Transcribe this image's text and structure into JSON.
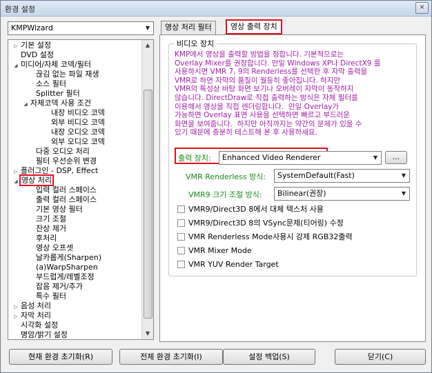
{
  "window": {
    "title": "환경 설정",
    "close_icon": "×"
  },
  "left": {
    "profile_combo": "KMPWizard",
    "tree": [
      {
        "label": "기본 설정",
        "exp": "▷",
        "indent": 0
      },
      {
        "label": "DVD 설정",
        "exp": "",
        "indent": 0
      },
      {
        "label": "미디어/자체 코덱/필터",
        "exp": "◢",
        "indent": 0
      },
      {
        "label": "끊김 없는 파일 재생",
        "exp": "",
        "indent": 2
      },
      {
        "label": "소스 필터",
        "exp": "",
        "indent": 2
      },
      {
        "label": "Splitter 필터",
        "exp": "",
        "indent": 2
      },
      {
        "label": "자체코덱 사용 조건",
        "exp": "◢",
        "indent": 1
      },
      {
        "label": "내장 비디오 코덱",
        "exp": "",
        "indent": 3
      },
      {
        "label": "외부 비디오 코덱",
        "exp": "",
        "indent": 3
      },
      {
        "label": "내장 오디오 코덱",
        "exp": "",
        "indent": 3
      },
      {
        "label": "외부 오디오 코덱",
        "exp": "",
        "indent": 3
      },
      {
        "label": "다중 오디오 처리",
        "exp": "",
        "indent": 2
      },
      {
        "label": "필터 우선순위 변경",
        "exp": "",
        "indent": 2
      },
      {
        "label": "플러그인 - DSP, Effect",
        "exp": "▷",
        "indent": 0
      },
      {
        "label": "영상 처리",
        "exp": "◢",
        "indent": 0,
        "selected": true
      },
      {
        "label": "입력 컬러 스페이스",
        "exp": "",
        "indent": 2
      },
      {
        "label": "출력 컬러 스페이스",
        "exp": "",
        "indent": 2
      },
      {
        "label": "기본 영상 필터",
        "exp": "",
        "indent": 2
      },
      {
        "label": "크기 조절",
        "exp": "",
        "indent": 2
      },
      {
        "label": "잔상 제거",
        "exp": "",
        "indent": 2
      },
      {
        "label": "후처리",
        "exp": "",
        "indent": 2
      },
      {
        "label": "영상 오프셋",
        "exp": "",
        "indent": 2
      },
      {
        "label": "날카롭게(Sharpen)",
        "exp": "",
        "indent": 2
      },
      {
        "label": "(a)WarpSharpen",
        "exp": "",
        "indent": 2
      },
      {
        "label": "부드럽게/레벨조정",
        "exp": "",
        "indent": 2
      },
      {
        "label": "잡음 제거/추가",
        "exp": "",
        "indent": 2
      },
      {
        "label": "특수 필터",
        "exp": "",
        "indent": 2
      },
      {
        "label": "음성 처리",
        "exp": "▷",
        "indent": 0
      },
      {
        "label": "자막 처리",
        "exp": "▷",
        "indent": 0
      },
      {
        "label": "시각화 설정",
        "exp": "",
        "indent": 0
      },
      {
        "label": "명암/밝기 설정",
        "exp": "",
        "indent": 0
      }
    ]
  },
  "tabs": [
    {
      "label": "영상 처리 필터",
      "active": false
    },
    {
      "label": "영상 출력 장치",
      "active": true
    }
  ],
  "video_device": {
    "group_title": "비디오 장치",
    "description": "KMP에서 영상을 출력할 방법을 정합니다. 기본적으로는\nOverlay Mixer를 권장합니다. 만일 Windows XP나 DirectX9 를\n사용하시면 VMR 7, 9의 Renderless를 선택한 후 자막 출력을\nVMR로 하면 자막의 품질이 월등히 좋아집니다. 하지만\nVMR의 특성상 바탕 화면 보기나 오버레이 자막이 동작하지\n않습니다. DirectDraw로 직접 출력하는 방식은 자체 필터를\n이용해서 영상을 직접 렌더링합니다.  만일 Overlay가\n가능하면 Overlay 표면 사용을 선택하면 빠르고 부드러운\n화면을 보여줍니다.  하지만 아직까지는 약간의 문제가 있을 수\n있기 때문에 충분히 테스트해 본 후 사용하세요.",
    "output_label": "출력 장치:",
    "output_value": "Enhanced Video Renderer",
    "browse_label": "...",
    "renderless_label": "VMR Renderless 방식:",
    "renderless_value": "SystemDefault(Fast)",
    "resize_label": "VMR9 크기 조절 방식:",
    "resize_value": "Bilinear(권장)",
    "checkboxes": [
      "VMR9/Direct3D 8에서 대체 텍스처 사용",
      "VMR9/Direct3D 8의 VSync문제(티어링) 수정",
      "VMR Renderless Mode사용시 강제 RGB32출력",
      "VMR Mixer Mode",
      "VMR YUV Render Target"
    ]
  },
  "buttons": {
    "reset_current": "현재 환경 초기화(R)",
    "reset_all": "전체 환경 초기화(I)",
    "backup": "설정 백업(S)",
    "close": "닫기(C)"
  }
}
